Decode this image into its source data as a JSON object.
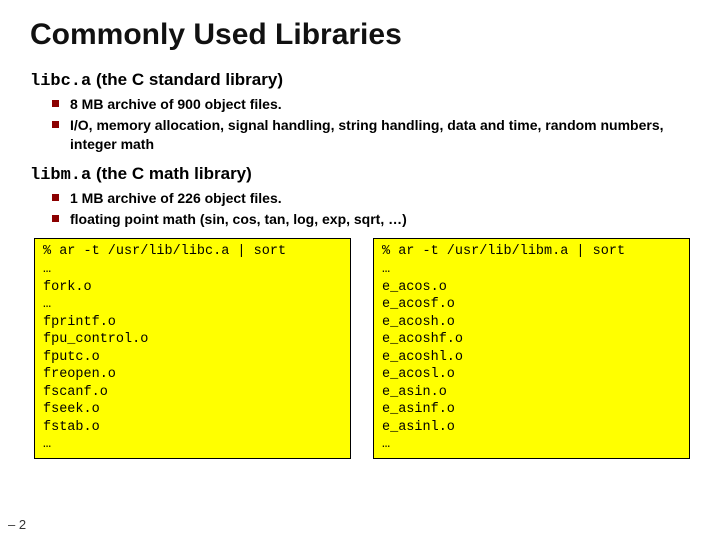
{
  "title": "Commonly Used Libraries",
  "libc": {
    "heading_code": "libc.a",
    "heading_rest": " (the C standard library)",
    "bullets": [
      "8 MB archive of 900 object files.",
      "I/O, memory allocation, signal handling, string handling, data and time, random numbers, integer math"
    ]
  },
  "libm": {
    "heading_code": "libm.a",
    "heading_rest": " (the C math library)",
    "bullets": [
      "1 MB archive of 226 object files.",
      "floating point math (sin, cos, tan, log, exp, sqrt, …)"
    ]
  },
  "code_left": "% ar -t /usr/lib/libc.a | sort\n…\nfork.o\n…\nfprintf.o\nfpu_control.o\nfputc.o\nfreopen.o\nfscanf.o\nfseek.o\nfstab.o\n…",
  "code_right": "% ar -t /usr/lib/libm.a | sort\n…\ne_acos.o\ne_acosf.o\ne_acosh.o\ne_acoshf.o\ne_acoshl.o\ne_acosl.o\ne_asin.o\ne_asinf.o\ne_asinl.o\n…",
  "page_marker": "– 2"
}
